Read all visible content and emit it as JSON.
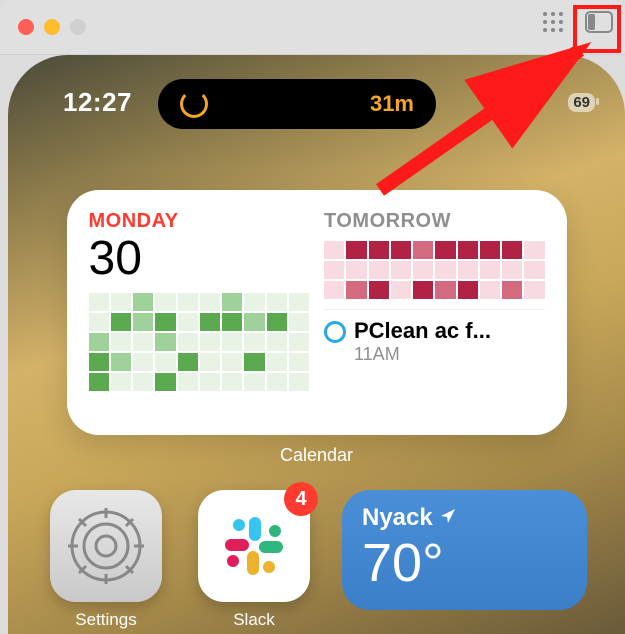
{
  "window": {
    "traffic": {
      "close": "#ff5f57",
      "minimize": "#febc2e",
      "maximize": "#d0d0d0"
    }
  },
  "statusbar": {
    "time": "12:27",
    "island_text": "31m",
    "battery": "69"
  },
  "calendar_widget": {
    "label": "Calendar",
    "today": {
      "label": "MONDAY",
      "date": "30"
    },
    "tomorrow": {
      "label": "TOMORROW",
      "event": {
        "title": "PClean ac f...",
        "time": "11AM"
      }
    }
  },
  "apps": {
    "settings": {
      "label": "Settings"
    },
    "slack": {
      "label": "Slack",
      "badge": "4"
    }
  },
  "weather": {
    "location": "Nyack",
    "temp": "70°"
  }
}
